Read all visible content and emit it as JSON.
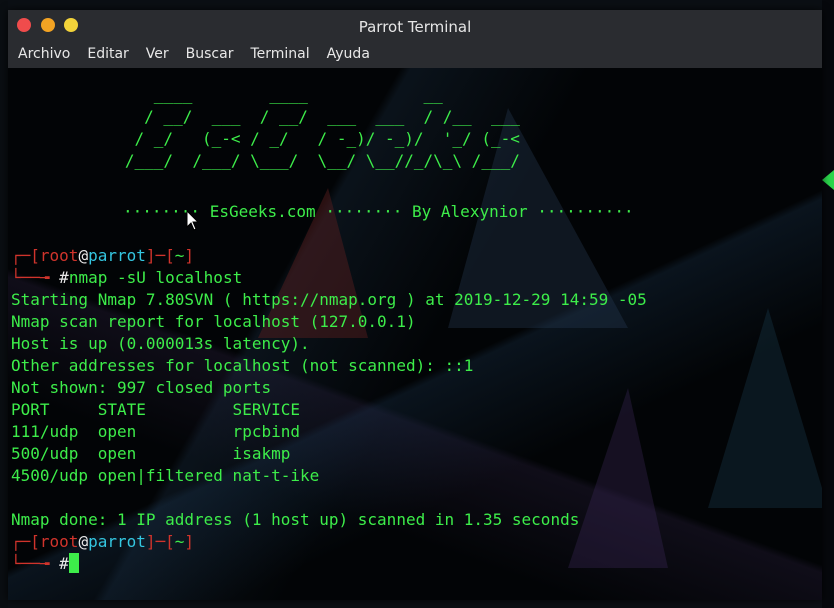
{
  "window": {
    "title": "Parrot Terminal"
  },
  "menu": [
    "Archivo",
    "Editar",
    "Ver",
    "Buscar",
    "Terminal",
    "Ayuda"
  ],
  "banner": {
    "art": "      ____        ____            __       \n     / __/  ___  / __/  ___  ___  / /__  ___\n    / _/   (_-< / _/   / -_)/ -_)/  '_/ (_-<\n   /___/  /___/ \\___/  \\__/ \\__//_/\\_\\ /___/",
    "dots_left": "········",
    "site": "EsGeeks.com",
    "dots_mid": "········",
    "author": "By Alexynior",
    "dots_right": "··········"
  },
  "prompt": {
    "user": "root",
    "at": "@",
    "host": "parrot",
    "dir": "~",
    "symbol": "#"
  },
  "command": "nmap -sU localhost",
  "output": [
    "Starting Nmap 7.80SVN ( https://nmap.org ) at 2019-12-29 14:59 -05",
    "Nmap scan report for localhost (127.0.0.1)",
    "Host is up (0.000013s latency).",
    "Other addresses for localhost (not scanned): ::1",
    "Not shown: 997 closed ports",
    "PORT     STATE         SERVICE",
    "111/udp  open          rpcbind",
    "500/udp  open          isakmp",
    "4500/udp open|filtered nat-t-ike",
    "",
    "Nmap done: 1 IP address (1 host up) scanned in 1.35 seconds"
  ],
  "colors": {
    "green": "#3ded4a",
    "red": "#d0342c",
    "cyan": "#34c6e0"
  }
}
